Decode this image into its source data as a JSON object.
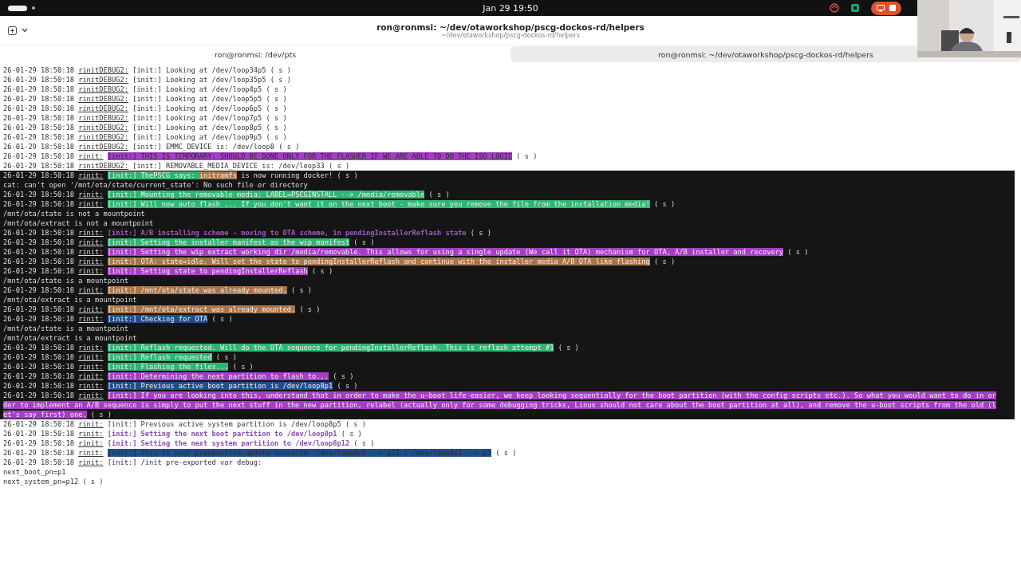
{
  "top_bar": {
    "clock": "Jan 29  19:50"
  },
  "window": {
    "title": "ron@ronmsi: ~/dev/otaworkshop/pscg-dockos-rd/helpers",
    "subtitle": "~/dev/otaworkshop/pscg-dockos-rd/helpers"
  },
  "tabs": [
    {
      "label": "ron@ronmsi: /dev/pts",
      "selected": false
    },
    {
      "label": "ron@ronmsi: ~/dev/otaworkshop/pscg-dockos-rd/helpers",
      "selected": true
    }
  ],
  "terminal": {
    "lines": [
      {
        "kind": "log",
        "dark": false,
        "time": "26-01-29 18:50:18",
        "tag": "rinitDEBUG2:",
        "segments": [
          {
            "kind": "plain",
            "text": "[init:] Looking at /dev/loop34p5 ( s )"
          }
        ]
      },
      {
        "kind": "log",
        "dark": false,
        "time": "26-01-29 18:50:18",
        "tag": "rinitDEBUG2:",
        "segments": [
          {
            "kind": "plain",
            "text": "[init:] Looking at /dev/loop35p5 ( s )"
          }
        ]
      },
      {
        "kind": "log",
        "dark": false,
        "time": "26-01-29 18:50:18",
        "tag": "rinitDEBUG2:",
        "segments": [
          {
            "kind": "plain",
            "text": "[init:] Looking at /dev/loop4p5 ( s )"
          }
        ]
      },
      {
        "kind": "log",
        "dark": false,
        "time": "26-01-29 18:50:18",
        "tag": "rinitDEBUG2:",
        "segments": [
          {
            "kind": "plain",
            "text": "[init:] Looking at /dev/loop5p5 ( s )"
          }
        ]
      },
      {
        "kind": "log",
        "dark": false,
        "time": "26-01-29 18:50:18",
        "tag": "rinitDEBUG2:",
        "segments": [
          {
            "kind": "plain",
            "text": "[init:] Looking at /dev/loop6p5 ( s )"
          }
        ]
      },
      {
        "kind": "log",
        "dark": false,
        "time": "26-01-29 18:50:18",
        "tag": "rinitDEBUG2:",
        "segments": [
          {
            "kind": "plain",
            "text": "[init:] Looking at /dev/loop7p5 ( s )"
          }
        ]
      },
      {
        "kind": "log",
        "dark": false,
        "time": "26-01-29 18:50:18",
        "tag": "rinitDEBUG2:",
        "segments": [
          {
            "kind": "plain",
            "text": "[init:] Looking at /dev/loop8p5 ( s )"
          }
        ]
      },
      {
        "kind": "log",
        "dark": false,
        "time": "26-01-29 18:50:18",
        "tag": "rinitDEBUG2:",
        "segments": [
          {
            "kind": "plain",
            "text": "[init:] Looking at /dev/loop9p5 ( s )"
          }
        ]
      },
      {
        "kind": "log",
        "dark": false,
        "time": "26-01-29 18:50:18",
        "tag": "rinitDEBUG2:",
        "segments": [
          {
            "kind": "plain",
            "text": "[init:] EMMC_DEVICE is: /dev/loop8 ( s )"
          }
        ]
      },
      {
        "kind": "log",
        "dark": false,
        "time": "26-01-29 18:50:18",
        "tag": "rinit:",
        "segments": [
          {
            "kind": "highlight",
            "text": "[init:] THIS IS TEMPORARY: SHOULD BE DONE ONLY FOR THE FLASHER IF WE ARE ABLE TO DO THE ISO LOGIC",
            "color": "#a43fc4"
          },
          {
            "kind": "plain",
            "text": " ( s )"
          }
        ]
      },
      {
        "kind": "log",
        "dark": false,
        "time": "26-01-29 18:50:18",
        "tag": "rinitDEBUG2:",
        "segments": [
          {
            "kind": "plain",
            "text": "[init:] REMOVABLE_MEDIA_DEVICE is: /dev/loop33 ( s )"
          }
        ]
      },
      {
        "kind": "log",
        "dark": true,
        "time": "26-01-29 18:50:18",
        "tag": "rinit:",
        "segments": [
          {
            "kind": "highlight",
            "text": "[init:] ThePSCG says: ",
            "color": "#2fb573"
          },
          {
            "kind": "highlight",
            "text": "initramfs",
            "color": "#a8764a"
          },
          {
            "kind": "plain",
            "text": " is now running docker! ( s )"
          }
        ]
      },
      {
        "kind": "plain",
        "dark": true,
        "text": "cat: can't open '/mnt/ota/state/current_state': No such file or directory"
      },
      {
        "kind": "log",
        "dark": true,
        "time": "26-01-29 18:50:18",
        "tag": "rinit:",
        "segments": [
          {
            "kind": "highlight",
            "text": "[init:] Mounting the removable media: LABEL=PSCGINSTALL --> /media/removable",
            "color": "#2fb573"
          },
          {
            "kind": "plain",
            "text": " ( s )"
          }
        ]
      },
      {
        "kind": "log",
        "dark": true,
        "time": "26-01-29 18:50:18",
        "tag": "rinit:",
        "segments": [
          {
            "kind": "highlight",
            "text": "[init:] Will now auto flash ... If you don't want it on the next boot - make sure you remove the file from the installation media!",
            "color": "#2fb573"
          },
          {
            "kind": "plain",
            "text": " ( s )"
          }
        ]
      },
      {
        "kind": "plain",
        "dark": true,
        "text": "/mnt/ota/state is not a mountpoint"
      },
      {
        "kind": "plain",
        "dark": true,
        "text": "/mnt/ota/extract is not a mountpoint"
      },
      {
        "kind": "log",
        "dark": true,
        "time": "26-01-29 18:50:18",
        "tag": "rinit:",
        "segments": [
          {
            "kind": "accent",
            "text": "[init:] A/B installing scheme - moving to OTA scheme, in pendingInstallerReflash state",
            "color": "#9a5cc0"
          },
          {
            "kind": "plain",
            "text": " ( s )"
          }
        ]
      },
      {
        "kind": "log",
        "dark": true,
        "time": "26-01-29 18:50:18",
        "tag": "rinit:",
        "segments": [
          {
            "kind": "highlight",
            "text": "[init:] Setting the installer manifest as the wip manifest",
            "color": "#2fb573"
          },
          {
            "kind": "plain",
            "text": " ( s )"
          }
        ]
      },
      {
        "kind": "log",
        "dark": true,
        "time": "26-01-29 18:50:18",
        "tag": "rinit:",
        "segments": [
          {
            "kind": "highlight",
            "text": "[init:] Setting the wip extract working dir /media/removable. This allows for using a single update (We call it OTA) mechanism for OTA, A/B installer and recovery",
            "color": "#a43fc4"
          },
          {
            "kind": "plain",
            "text": " ( s )"
          }
        ]
      },
      {
        "kind": "log",
        "dark": true,
        "time": "26-01-29 18:50:18",
        "tag": "rinit:",
        "segments": [
          {
            "kind": "highlight",
            "text": "[init:] OTA: state=idle. Will set the state to pendingInstallerReflash and continue with the installer media A/B OTA like flashing",
            "color": "#a8764a"
          },
          {
            "kind": "plain",
            "text": " ( s )"
          }
        ]
      },
      {
        "kind": "log",
        "dark": true,
        "time": "26-01-29 18:50:18",
        "tag": "rinit:",
        "segments": [
          {
            "kind": "highlight",
            "text": "[init:] Setting state to pendingInstallerReflash",
            "color": "#a43fc4"
          },
          {
            "kind": "plain",
            "text": " ( s )"
          }
        ]
      },
      {
        "kind": "plain",
        "dark": true,
        "text": "/mnt/ota/state is a mountpoint"
      },
      {
        "kind": "log",
        "dark": true,
        "time": "26-01-29 18:50:18",
        "tag": "rinit:",
        "segments": [
          {
            "kind": "highlight",
            "text": "[init:] /mnt/ota/state was already mounted.",
            "color": "#a8764a"
          },
          {
            "kind": "plain",
            "text": " ( s )"
          }
        ]
      },
      {
        "kind": "plain",
        "dark": true,
        "text": "/mnt/ota/extract is a mountpoint"
      },
      {
        "kind": "log",
        "dark": true,
        "time": "26-01-29 18:50:18",
        "tag": "rinit:",
        "segments": [
          {
            "kind": "highlight",
            "text": "[init:] /mnt/ota/extract was already mounted.",
            "color": "#a8764a"
          },
          {
            "kind": "plain",
            "text": " ( s )"
          }
        ]
      },
      {
        "kind": "log",
        "dark": true,
        "time": "26-01-29 18:50:18",
        "tag": "rinit:",
        "segments": [
          {
            "kind": "highlight",
            "text": "[init:] Checking for OTA",
            "color": "#214f8c"
          },
          {
            "kind": "plain",
            "text": " ( s )"
          }
        ]
      },
      {
        "kind": "plain",
        "dark": true,
        "text": "/mnt/ota/state is a mountpoint"
      },
      {
        "kind": "plain",
        "dark": true,
        "text": "/mnt/ota/extract is a mountpoint"
      },
      {
        "kind": "log",
        "dark": true,
        "time": "26-01-29 18:50:18",
        "tag": "rinit:",
        "segments": [
          {
            "kind": "highlight",
            "text": "[init:] Reflash requested. Will do the OTA sequence for pendingInstallerReflash. This is reflash attempt #1",
            "color": "#2fb573"
          },
          {
            "kind": "plain",
            "text": " ( s )"
          }
        ]
      },
      {
        "kind": "log",
        "dark": true,
        "time": "26-01-29 18:50:18",
        "tag": "rinit:",
        "segments": [
          {
            "kind": "highlight",
            "text": "[init:] Reflash requested",
            "color": "#2fb573"
          },
          {
            "kind": "plain",
            "text": " ( s )"
          }
        ]
      },
      {
        "kind": "log",
        "dark": true,
        "time": "26-01-29 18:50:18",
        "tag": "rinit:",
        "segments": [
          {
            "kind": "highlight",
            "text": "[init:] Flashing the files...",
            "color": "#2fb573"
          },
          {
            "kind": "plain",
            "text": " ( s )"
          }
        ]
      },
      {
        "kind": "log",
        "dark": true,
        "time": "26-01-29 18:50:18",
        "tag": "rinit:",
        "segments": [
          {
            "kind": "highlight",
            "text": "[init:] Determining the next partition to flash to...",
            "color": "#a43fc4"
          },
          {
            "kind": "plain",
            "text": " ( s )"
          }
        ]
      },
      {
        "kind": "log",
        "dark": true,
        "time": "26-01-29 18:50:18",
        "tag": "rinit:",
        "segments": [
          {
            "kind": "highlight",
            "text": "[init:] Previous active boot partition is /dev/loop8p1",
            "color": "#214f8c"
          },
          {
            "kind": "plain",
            "text": " ( s )"
          }
        ]
      },
      {
        "kind": "log",
        "dark": true,
        "time": "26-01-29 18:50:18",
        "tag": "rinit:",
        "segments": [
          {
            "kind": "highlight",
            "text": "[init:] If you are looking into this, understand that in order to make the u-boot life easier, we keep looking sequentially for the boot partition (with the config scripts etc.). So what you would want to do in or",
            "color": "#a43fc4"
          }
        ]
      },
      {
        "kind": "continuation",
        "dark": true,
        "segments": [
          {
            "kind": "highlight",
            "text": "der to implement an A/B sequence is simply to put the next stuff in the new partition, relabel (actually only for some debugging tricks, Linux should not care about the boot partition at all), and remove the u-boot scripts from the old (l",
            "color": "#a43fc4"
          }
        ]
      },
      {
        "kind": "continuation",
        "dark": true,
        "segments": [
          {
            "kind": "highlight",
            "text": "et's say first) one.",
            "color": "#a43fc4"
          },
          {
            "kind": "plain",
            "text": " ( s )"
          }
        ]
      },
      {
        "kind": "log",
        "dark": false,
        "time": "26-01-29 18:50:18",
        "tag": "rinit:",
        "segments": [
          {
            "kind": "plain",
            "text": "[init:] Previous active system partition is /dev/loop8p5 ( s )"
          }
        ]
      },
      {
        "kind": "log",
        "dark": false,
        "time": "26-01-29 18:50:18",
        "tag": "rinit:",
        "segments": [
          {
            "kind": "accent",
            "text": "[init:] Setting the next boot partition to /dev/loop8p1",
            "color": "#8a4bb0"
          },
          {
            "kind": "plain",
            "text": " ( s )"
          }
        ]
      },
      {
        "kind": "log",
        "dark": false,
        "time": "26-01-29 18:50:18",
        "tag": "rinit:",
        "segments": [
          {
            "kind": "accent",
            "text": "[init:] Setting the next system partition to /dev/loop8p12",
            "color": "#8a4bb0"
          },
          {
            "kind": "plain",
            "text": " ( s )"
          }
        ]
      },
      {
        "kind": "log",
        "dark": false,
        "time": "26-01-29 18:50:18",
        "tag": "rinit:",
        "segments": [
          {
            "kind": "highlight",
            "text": "[init:] This is your prospective update scenario: /dev/loop8p5 --> p12 ; /dev/loop8p1 --> p1",
            "color": "#214f8c"
          },
          {
            "kind": "plain",
            "text": " ( s )"
          }
        ]
      },
      {
        "kind": "log",
        "dark": false,
        "time": "26-01-29 18:50:18",
        "tag": "rinit:",
        "segments": [
          {
            "kind": "plain",
            "text": "[init:] /init pre-exported var debug:"
          }
        ]
      },
      {
        "kind": "plain",
        "dark": false,
        "text": "next_boot_pn=p1"
      },
      {
        "kind": "plain",
        "dark": false,
        "text": "next_system_pn=p12 ( s )"
      }
    ]
  }
}
